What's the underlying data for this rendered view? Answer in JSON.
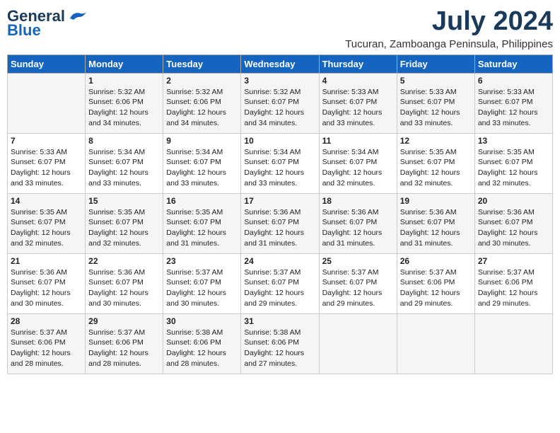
{
  "header": {
    "logo_general": "General",
    "logo_blue": "Blue",
    "month_year": "July 2024",
    "location": "Tucuran, Zamboanga Peninsula, Philippines"
  },
  "days_of_week": [
    "Sunday",
    "Monday",
    "Tuesday",
    "Wednesday",
    "Thursday",
    "Friday",
    "Saturday"
  ],
  "weeks": [
    {
      "days": [
        {
          "num": "",
          "info": ""
        },
        {
          "num": "1",
          "info": "Sunrise: 5:32 AM\nSunset: 6:06 PM\nDaylight: 12 hours\nand 34 minutes."
        },
        {
          "num": "2",
          "info": "Sunrise: 5:32 AM\nSunset: 6:06 PM\nDaylight: 12 hours\nand 34 minutes."
        },
        {
          "num": "3",
          "info": "Sunrise: 5:32 AM\nSunset: 6:07 PM\nDaylight: 12 hours\nand 34 minutes."
        },
        {
          "num": "4",
          "info": "Sunrise: 5:33 AM\nSunset: 6:07 PM\nDaylight: 12 hours\nand 33 minutes."
        },
        {
          "num": "5",
          "info": "Sunrise: 5:33 AM\nSunset: 6:07 PM\nDaylight: 12 hours\nand 33 minutes."
        },
        {
          "num": "6",
          "info": "Sunrise: 5:33 AM\nSunset: 6:07 PM\nDaylight: 12 hours\nand 33 minutes."
        }
      ]
    },
    {
      "days": [
        {
          "num": "7",
          "info": "Sunrise: 5:33 AM\nSunset: 6:07 PM\nDaylight: 12 hours\nand 33 minutes."
        },
        {
          "num": "8",
          "info": "Sunrise: 5:34 AM\nSunset: 6:07 PM\nDaylight: 12 hours\nand 33 minutes."
        },
        {
          "num": "9",
          "info": "Sunrise: 5:34 AM\nSunset: 6:07 PM\nDaylight: 12 hours\nand 33 minutes."
        },
        {
          "num": "10",
          "info": "Sunrise: 5:34 AM\nSunset: 6:07 PM\nDaylight: 12 hours\nand 33 minutes."
        },
        {
          "num": "11",
          "info": "Sunrise: 5:34 AM\nSunset: 6:07 PM\nDaylight: 12 hours\nand 32 minutes."
        },
        {
          "num": "12",
          "info": "Sunrise: 5:35 AM\nSunset: 6:07 PM\nDaylight: 12 hours\nand 32 minutes."
        },
        {
          "num": "13",
          "info": "Sunrise: 5:35 AM\nSunset: 6:07 PM\nDaylight: 12 hours\nand 32 minutes."
        }
      ]
    },
    {
      "days": [
        {
          "num": "14",
          "info": "Sunrise: 5:35 AM\nSunset: 6:07 PM\nDaylight: 12 hours\nand 32 minutes."
        },
        {
          "num": "15",
          "info": "Sunrise: 5:35 AM\nSunset: 6:07 PM\nDaylight: 12 hours\nand 32 minutes."
        },
        {
          "num": "16",
          "info": "Sunrise: 5:35 AM\nSunset: 6:07 PM\nDaylight: 12 hours\nand 31 minutes."
        },
        {
          "num": "17",
          "info": "Sunrise: 5:36 AM\nSunset: 6:07 PM\nDaylight: 12 hours\nand 31 minutes."
        },
        {
          "num": "18",
          "info": "Sunrise: 5:36 AM\nSunset: 6:07 PM\nDaylight: 12 hours\nand 31 minutes."
        },
        {
          "num": "19",
          "info": "Sunrise: 5:36 AM\nSunset: 6:07 PM\nDaylight: 12 hours\nand 31 minutes."
        },
        {
          "num": "20",
          "info": "Sunrise: 5:36 AM\nSunset: 6:07 PM\nDaylight: 12 hours\nand 30 minutes."
        }
      ]
    },
    {
      "days": [
        {
          "num": "21",
          "info": "Sunrise: 5:36 AM\nSunset: 6:07 PM\nDaylight: 12 hours\nand 30 minutes."
        },
        {
          "num": "22",
          "info": "Sunrise: 5:36 AM\nSunset: 6:07 PM\nDaylight: 12 hours\nand 30 minutes."
        },
        {
          "num": "23",
          "info": "Sunrise: 5:37 AM\nSunset: 6:07 PM\nDaylight: 12 hours\nand 30 minutes."
        },
        {
          "num": "24",
          "info": "Sunrise: 5:37 AM\nSunset: 6:07 PM\nDaylight: 12 hours\nand 29 minutes."
        },
        {
          "num": "25",
          "info": "Sunrise: 5:37 AM\nSunset: 6:07 PM\nDaylight: 12 hours\nand 29 minutes."
        },
        {
          "num": "26",
          "info": "Sunrise: 5:37 AM\nSunset: 6:06 PM\nDaylight: 12 hours\nand 29 minutes."
        },
        {
          "num": "27",
          "info": "Sunrise: 5:37 AM\nSunset: 6:06 PM\nDaylight: 12 hours\nand 29 minutes."
        }
      ]
    },
    {
      "days": [
        {
          "num": "28",
          "info": "Sunrise: 5:37 AM\nSunset: 6:06 PM\nDaylight: 12 hours\nand 28 minutes."
        },
        {
          "num": "29",
          "info": "Sunrise: 5:37 AM\nSunset: 6:06 PM\nDaylight: 12 hours\nand 28 minutes."
        },
        {
          "num": "30",
          "info": "Sunrise: 5:38 AM\nSunset: 6:06 PM\nDaylight: 12 hours\nand 28 minutes."
        },
        {
          "num": "31",
          "info": "Sunrise: 5:38 AM\nSunset: 6:06 PM\nDaylight: 12 hours\nand 27 minutes."
        },
        {
          "num": "",
          "info": ""
        },
        {
          "num": "",
          "info": ""
        },
        {
          "num": "",
          "info": ""
        }
      ]
    }
  ]
}
